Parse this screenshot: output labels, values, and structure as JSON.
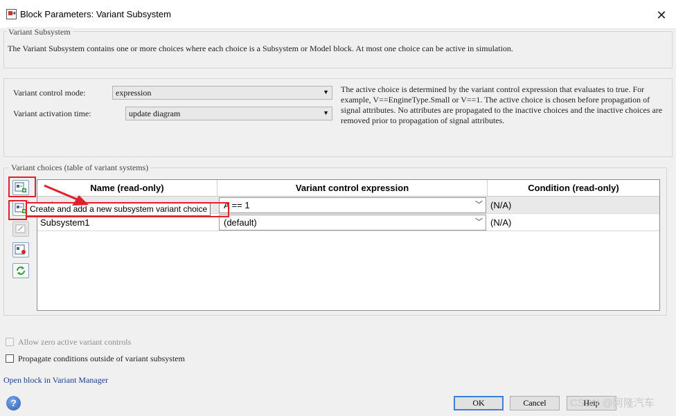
{
  "window": {
    "title": "Block Parameters: Variant Subsystem",
    "close_glyph": "✕"
  },
  "description": {
    "legend": "Variant Subsystem",
    "text": "The Variant Subsystem contains one or more choices where each choice is a Subsystem or Model block. At most one choice can be active in simulation."
  },
  "mode": {
    "control_label": "Variant control mode:",
    "control_value": "expression",
    "activation_label": "Variant activation time:",
    "activation_value": "update diagram",
    "help": "The active choice is determined by the variant control expression that evaluates to true. For example, V==EngineType.Small or V==1. The active choice is chosen before propagation of signal attributes. No attributes are propagated to the inactive choices and the inactive choices are removed prior to propagation of signal attributes."
  },
  "choices": {
    "legend": "Variant choices (table of variant systems)",
    "columns": [
      "Name (read-only)",
      "Variant control expression",
      "Condition (read-only)"
    ],
    "rows": [
      {
        "name": "Subsystem",
        "expression": "A == 1",
        "condition": "(N/A)"
      },
      {
        "name": "Subsystem1",
        "expression": "(default)",
        "condition": "(N/A)"
      }
    ],
    "tooltip": "Create and add a new subsystem variant choice",
    "side_buttons": [
      "add-model-variant-icon",
      "add-subsystem-variant-icon",
      "comment-icon",
      "open-block-icon",
      "refresh-icon"
    ]
  },
  "options": {
    "allow_zero_label": "Allow zero active variant controls",
    "allow_zero_checked": false,
    "allow_zero_enabled": false,
    "propagate_label": "Propagate conditions outside of variant subsystem",
    "propagate_checked": false,
    "manager_link": "Open block in Variant Manager"
  },
  "footer": {
    "help_glyph": "?",
    "ok_label": "OK",
    "cancel_label": "Cancel",
    "help_label": "Help",
    "watermark": "CSDN @阿隆汽车"
  },
  "colors": {
    "callout": "#e0202a",
    "link": "#1a3b8c",
    "default_button": "#3c7fd6"
  }
}
